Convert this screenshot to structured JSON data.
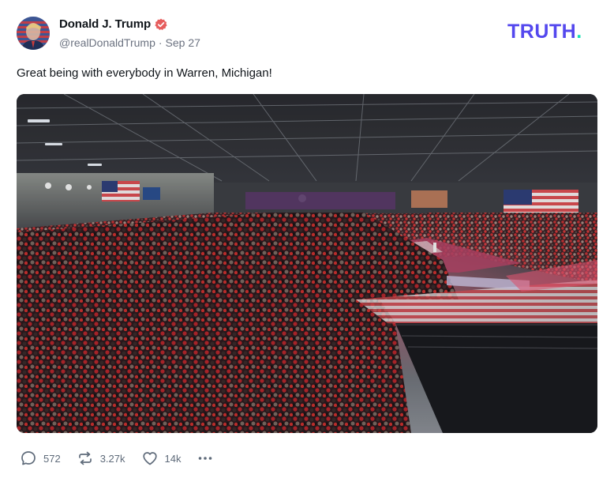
{
  "post": {
    "author": {
      "display_name": "Donald J. Trump",
      "handle": "@realDonaldTrump",
      "verified": true,
      "avatar_icon": "american-flag-portrait"
    },
    "separator": "·",
    "date": "Sep 27",
    "text": "Great being with everybody in Warren, Michigan!",
    "media": {
      "kind": "photo",
      "subject": "rally-crowd-arena"
    },
    "actions": {
      "replies_count": "572",
      "reposts_count": "3.27k",
      "likes_count": "14k",
      "reply_icon": "comment-icon",
      "repost_icon": "repost-icon",
      "like_icon": "heart-icon",
      "more_icon": "ellipsis-icon"
    }
  },
  "brand": {
    "logo_text": "TRUTH",
    "logo_dot": ".",
    "logo_color": "#5448ee",
    "dot_color": "#17e0b4"
  },
  "colors": {
    "verified_badge": "#e65d5d",
    "meta_text": "#6b7280",
    "action_text": "#5f6b7a"
  }
}
